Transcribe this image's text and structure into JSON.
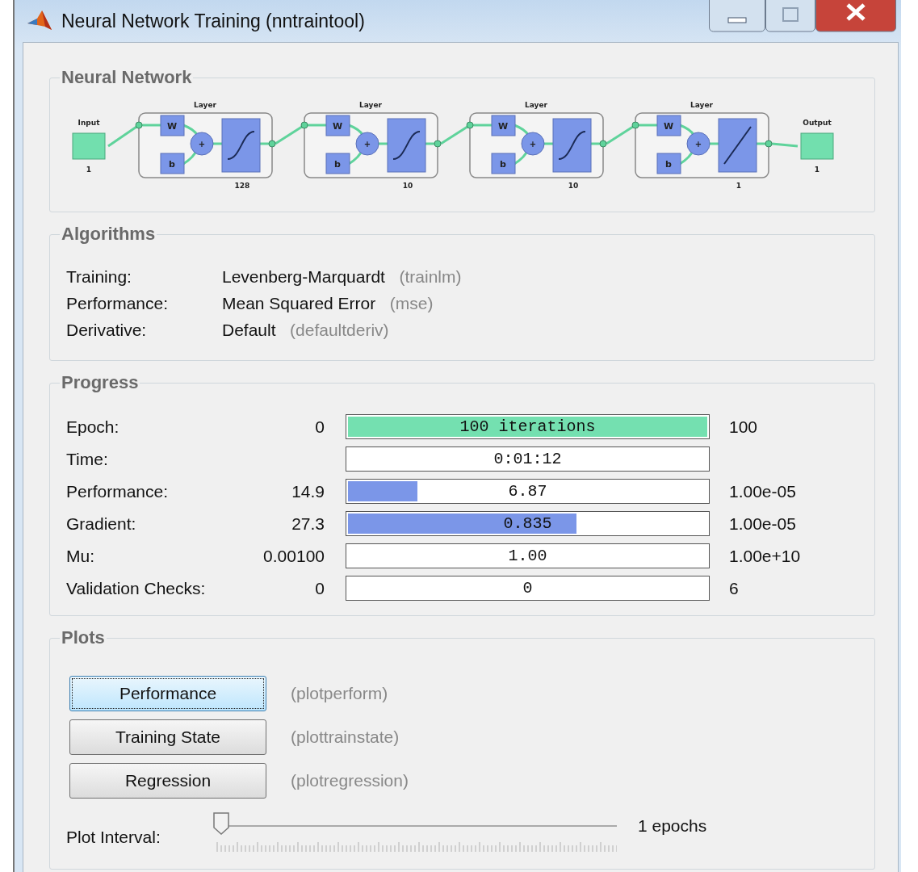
{
  "window": {
    "title": "Neural Network Training (nntraintool)"
  },
  "network": {
    "title": "Neural Network",
    "input": {
      "label": "Input",
      "size": "1"
    },
    "output": {
      "label": "Output",
      "size": "1"
    },
    "layers": [
      {
        "label": "Layer",
        "weight": "W",
        "bias": "b",
        "sum": "+",
        "size": "128",
        "kind": "sigmoid"
      },
      {
        "label": "Layer",
        "weight": "W",
        "bias": "b",
        "sum": "+",
        "size": "10",
        "kind": "sigmoid"
      },
      {
        "label": "Layer",
        "weight": "W",
        "bias": "b",
        "sum": "+",
        "size": "10",
        "kind": "sigmoid"
      },
      {
        "label": "Layer",
        "weight": "W",
        "bias": "b",
        "sum": "+",
        "size": "1",
        "kind": "linear"
      }
    ]
  },
  "algorithms": {
    "title": "Algorithms",
    "rows": [
      {
        "label": "Training:",
        "value": "Levenberg-Marquardt",
        "function": "(trainlm)"
      },
      {
        "label": "Performance:",
        "value": "Mean Squared Error",
        "function": "(mse)"
      },
      {
        "label": "Derivative:",
        "value": "Default",
        "function": "(defaultderiv)"
      }
    ]
  },
  "progress": {
    "title": "Progress",
    "rows": [
      {
        "label": "Epoch:",
        "start": "0",
        "reading": "100 iterations",
        "level": 1,
        "color": "#74e0b0",
        "end": "100"
      },
      {
        "label": "Time:",
        "reading": "0:01:12",
        "level": 0
      },
      {
        "label": "Performance:",
        "start": "14.9",
        "reading": "6.87",
        "level": 0.2,
        "color": "#7b96e8",
        "end": "1.00e-05"
      },
      {
        "label": "Gradient:",
        "start": "27.3",
        "reading": "0.835",
        "level": 0.64,
        "color": "#7b96e8",
        "end": "1.00e-05"
      },
      {
        "label": "Mu:",
        "start": "0.00100",
        "reading": "1.00",
        "level": 0,
        "end": "1.00e+10"
      },
      {
        "label": "Validation Checks:",
        "start": "0",
        "reading": "0",
        "level": 0,
        "end": "6"
      }
    ]
  },
  "plots": {
    "title": "Plots",
    "buttons": [
      {
        "label": "Performance",
        "function": "(plotperform)",
        "focused": true
      },
      {
        "label": "Training State",
        "function": "(plottrainstate)",
        "focused": false
      },
      {
        "label": "Regression",
        "function": "(plotregression)",
        "focused": false
      }
    ],
    "interval": {
      "label": "Plot Interval:",
      "level": 0,
      "reading": "1 epochs"
    }
  }
}
